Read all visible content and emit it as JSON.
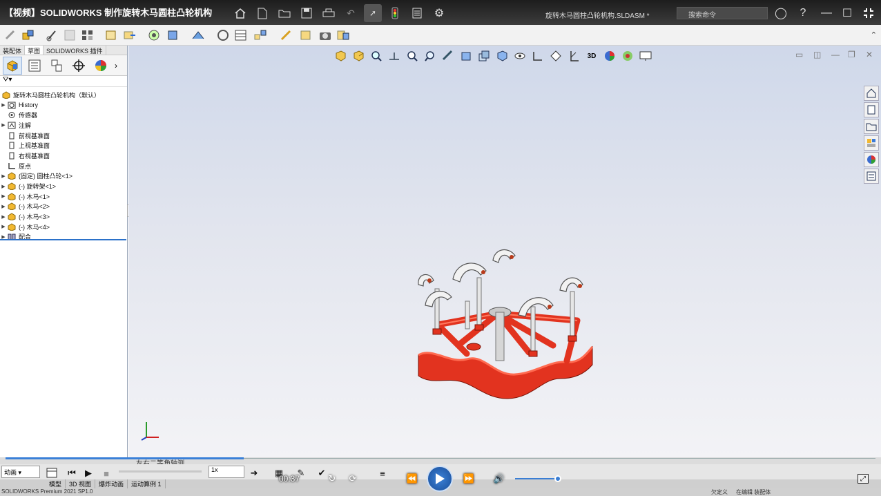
{
  "colors": {
    "accent": "#2b71c9",
    "model_red": "#e2331f",
    "titlebar": "#2b2b2b"
  },
  "video": {
    "title": "【视频】SOLIDWORKS 制作旋转木马圆柱凸轮机构",
    "time": "00:37",
    "volume": 0.9
  },
  "app": {
    "document_title": "旋转木马圆柱凸轮机构.SLDASM *",
    "search_placeholder": "搜索命令"
  },
  "panel": {
    "tabs": [
      "装配体",
      "草图",
      "SOLIDWORKS 插件"
    ],
    "active_tab": "装配体",
    "manager_tabs": [
      "featuremanager-icon",
      "propertymanager-icon",
      "configurationmanager-icon",
      "dimxpert-icon",
      "display-manager-icon"
    ]
  },
  "tree": {
    "root": "旋转木马圆柱凸轮机构（默认）",
    "items": [
      {
        "label": "History",
        "icon": "history-icon",
        "expand": true
      },
      {
        "label": "传感器",
        "icon": "sensor-icon",
        "expand": false
      },
      {
        "label": "注解",
        "icon": "annotation-icon",
        "expand": true
      },
      {
        "label": "前视基准面",
        "icon": "plane-icon",
        "expand": false
      },
      {
        "label": "上视基准面",
        "icon": "plane-icon",
        "expand": false
      },
      {
        "label": "右视基准面",
        "icon": "plane-icon",
        "expand": false
      },
      {
        "label": "原点",
        "icon": "origin-icon",
        "expand": false
      },
      {
        "label": "(固定) 圆柱凸轮<1>",
        "icon": "part-icon",
        "expand": true
      },
      {
        "label": "(-) 旋转架<1>",
        "icon": "part-icon",
        "expand": true
      },
      {
        "label": "(-) 木马<1>",
        "icon": "part-icon",
        "expand": true
      },
      {
        "label": "(-) 木马<2>",
        "icon": "part-icon",
        "expand": true
      },
      {
        "label": "(-) 木马<3>",
        "icon": "part-icon",
        "expand": true
      },
      {
        "label": "(-) 木马<4>",
        "icon": "part-icon",
        "expand": true
      },
      {
        "label": "配合",
        "icon": "mates-icon",
        "expand": true
      }
    ]
  },
  "motion": {
    "caption": "左右二等角轴测",
    "study_type": "动画",
    "speed": "1x"
  },
  "bottom_tabs": [
    "模型",
    "3D 视图",
    "爆炸动画",
    "运动算例 1"
  ],
  "status": {
    "left": "SOLIDWORKS Premium 2021 SP1.0",
    "right1": "欠定义",
    "right2": "在编辑 装配体"
  }
}
